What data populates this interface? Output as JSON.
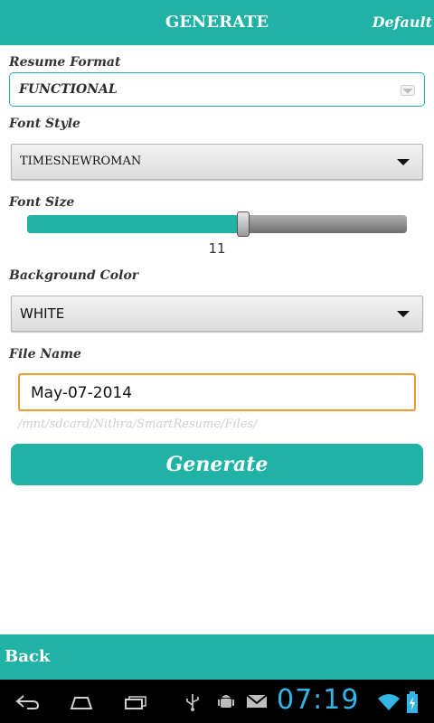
{
  "header": {
    "title": "GENERATE",
    "default_label": "Default"
  },
  "resume_format": {
    "label": "Resume Format",
    "value": "FUNCTIONAL"
  },
  "font_style": {
    "label": "Font Style",
    "value": "TIMESNEWROMAN"
  },
  "font_size": {
    "label": "Font Size",
    "value": "11",
    "fraction": 0.57
  },
  "background_color": {
    "label": "Background Color",
    "value": "WHITE"
  },
  "file_name": {
    "label": "File Name",
    "value": "May-07-2014",
    "path_hint": "/mnt/sdcard/Nithra/SmartResume/Files/"
  },
  "generate_button": {
    "label": "Generate"
  },
  "footer": {
    "back_label": "Back"
  },
  "status_bar": {
    "time": "07:19"
  },
  "nav_icons": [
    "back-icon",
    "home-icon",
    "recent-apps-icon",
    "usb-icon",
    "android-debug-icon",
    "gmail-icon",
    "wifi-icon",
    "battery-icon"
  ],
  "colors": {
    "accent": "#20b3a5",
    "focus": "#f2992e",
    "clock": "#33b5e5"
  }
}
